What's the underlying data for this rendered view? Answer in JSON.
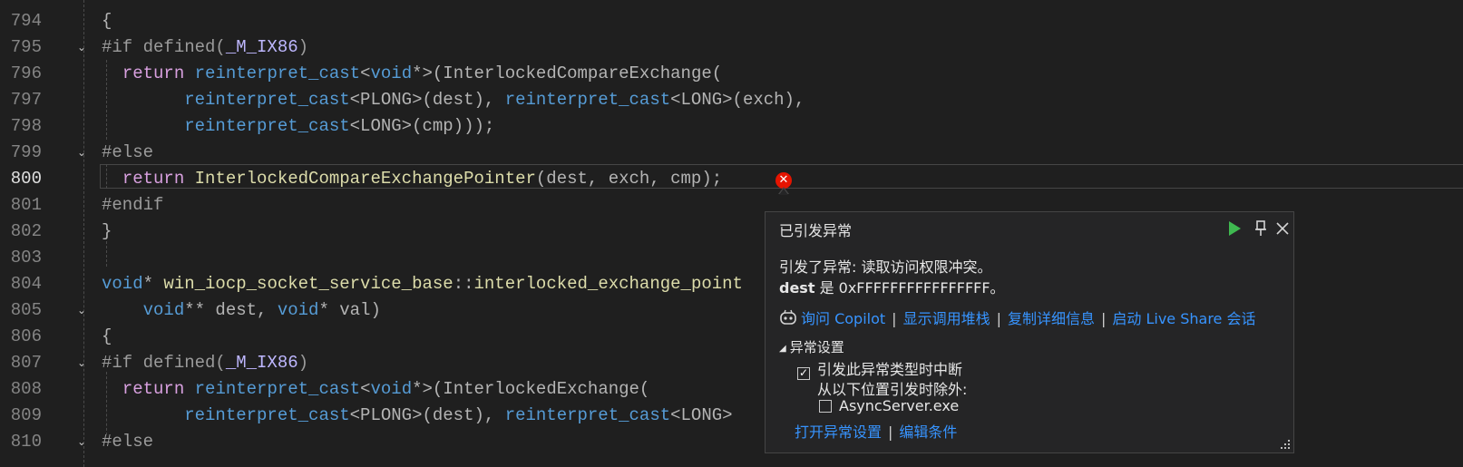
{
  "editor": {
    "lines": [
      {
        "num": "794",
        "segments": [
          {
            "t": "{",
            "c": "tok"
          }
        ]
      },
      {
        "num": "795",
        "segments": [
          {
            "t": "#if defined(",
            "c": "pp"
          },
          {
            "t": "_M_IX86",
            "c": "mac"
          },
          {
            "t": ")",
            "c": "pp"
          }
        ]
      },
      {
        "num": "796",
        "segments": [
          {
            "t": "  ",
            "c": "tok"
          },
          {
            "t": "return",
            "c": "ctl"
          },
          {
            "t": " ",
            "c": "tok"
          },
          {
            "t": "reinterpret_cast",
            "c": "kw"
          },
          {
            "t": "<",
            "c": "tok"
          },
          {
            "t": "void",
            "c": "kw"
          },
          {
            "t": "*>(InterlockedCompareExchange(",
            "c": "tok"
          }
        ]
      },
      {
        "num": "797",
        "segments": [
          {
            "t": "        ",
            "c": "tok"
          },
          {
            "t": "reinterpret_cast",
            "c": "kw"
          },
          {
            "t": "<PLONG>(dest), ",
            "c": "tok"
          },
          {
            "t": "reinterpret_cast",
            "c": "kw"
          },
          {
            "t": "<LONG>(exch),",
            "c": "tok"
          }
        ]
      },
      {
        "num": "798",
        "segments": [
          {
            "t": "        ",
            "c": "tok"
          },
          {
            "t": "reinterpret_cast",
            "c": "kw"
          },
          {
            "t": "<LONG>(cmp)));",
            "c": "tok"
          }
        ]
      },
      {
        "num": "799",
        "segments": [
          {
            "t": "#else",
            "c": "pp"
          }
        ]
      },
      {
        "num": "800",
        "segments": [
          {
            "t": "  ",
            "c": "tok"
          },
          {
            "t": "return",
            "c": "ctl"
          },
          {
            "t": " ",
            "c": "tok"
          },
          {
            "t": "InterlockedCompareExchangePointer",
            "c": "fn"
          },
          {
            "t": "(dest, exch, cmp);",
            "c": "tok"
          }
        ]
      },
      {
        "num": "801",
        "segments": [
          {
            "t": "#endif",
            "c": "pp"
          }
        ]
      },
      {
        "num": "802",
        "segments": [
          {
            "t": "}",
            "c": "tok"
          }
        ]
      },
      {
        "num": "803",
        "segments": []
      },
      {
        "num": "804",
        "segments": [
          {
            "t": "void",
            "c": "kw"
          },
          {
            "t": "* ",
            "c": "tok"
          },
          {
            "t": "win_iocp_socket_service_base",
            "c": "fn"
          },
          {
            "t": "::",
            "c": "tok"
          },
          {
            "t": "interlocked_exchange_point",
            "c": "fn"
          }
        ]
      },
      {
        "num": "805",
        "segments": [
          {
            "t": "    ",
            "c": "tok"
          },
          {
            "t": "void",
            "c": "kw"
          },
          {
            "t": "** dest, ",
            "c": "tok"
          },
          {
            "t": "void",
            "c": "kw"
          },
          {
            "t": "* val)",
            "c": "tok"
          }
        ]
      },
      {
        "num": "806",
        "segments": [
          {
            "t": "{",
            "c": "tok"
          }
        ]
      },
      {
        "num": "807",
        "segments": [
          {
            "t": "#if defined(",
            "c": "pp"
          },
          {
            "t": "_M_IX86",
            "c": "mac"
          },
          {
            "t": ")",
            "c": "pp"
          }
        ]
      },
      {
        "num": "808",
        "segments": [
          {
            "t": "  ",
            "c": "tok"
          },
          {
            "t": "return",
            "c": "ctl"
          },
          {
            "t": " ",
            "c": "tok"
          },
          {
            "t": "reinterpret_cast",
            "c": "kw"
          },
          {
            "t": "<",
            "c": "tok"
          },
          {
            "t": "void",
            "c": "kw"
          },
          {
            "t": "*>(InterlockedExchange(",
            "c": "tok"
          }
        ]
      },
      {
        "num": "809",
        "segments": [
          {
            "t": "        ",
            "c": "tok"
          },
          {
            "t": "reinterpret_cast",
            "c": "kw"
          },
          {
            "t": "<PLONG>(dest), ",
            "c": "tok"
          },
          {
            "t": "reinterpret_cast",
            "c": "kw"
          },
          {
            "t": "<LONG>",
            "c": "tok"
          }
        ]
      },
      {
        "num": "810",
        "segments": [
          {
            "t": "#else",
            "c": "pp"
          }
        ]
      }
    ],
    "current_line": "800",
    "fold_lines": [
      "795",
      "799",
      "805",
      "807",
      "810"
    ]
  },
  "exception_popup": {
    "title": "已引发异常",
    "message_line1": "引发了异常: 读取访问权限冲突。",
    "message_var": "dest",
    "message_rest": " 是 0xFFFFFFFFFFFFFFFF。",
    "links": {
      "copilot": "询问 Copilot",
      "call_stack": "显示调用堆栈",
      "copy_details": "复制详细信息",
      "live_share": "启动 Live Share 会话"
    },
    "settings_header": "异常设置",
    "break_checkbox_label": "引发此异常类型时中断",
    "break_checked": true,
    "except_label": "从以下位置引发时除外:",
    "module_checkbox_label": "AsyncServer.exe",
    "module_checked": false,
    "open_settings_link": "打开异常设置",
    "edit_conditions_link": "编辑条件",
    "icons": {
      "continue": "play-icon",
      "pin": "pin-icon",
      "close": "close-icon",
      "error": "error-icon",
      "copilot": "copilot-icon"
    },
    "colors": {
      "link": "#3794ff",
      "continue": "#3fb950",
      "error": "#e51400"
    }
  },
  "separator": "|"
}
